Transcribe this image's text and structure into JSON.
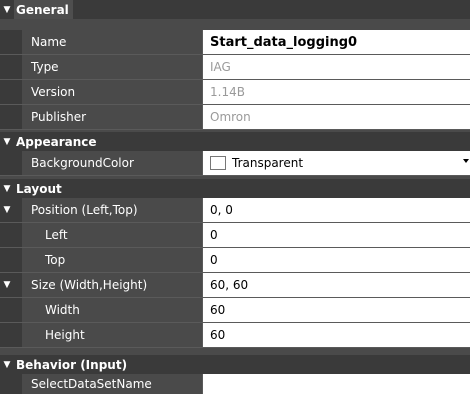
{
  "categories": {
    "general": "General",
    "appearance": "Appearance",
    "layout": "Layout",
    "behavior": "Behavior (Input)"
  },
  "general": {
    "name": {
      "label": "Name",
      "value": "Start_data_logging0"
    },
    "type": {
      "label": "Type",
      "value": "IAG"
    },
    "version": {
      "label": "Version",
      "value": "1.14B"
    },
    "publisher": {
      "label": "Publisher",
      "value": "Omron"
    }
  },
  "appearance": {
    "background_color": {
      "label": "BackgroundColor",
      "value": "Transparent"
    }
  },
  "layout": {
    "position": {
      "label": "Position (Left,Top)",
      "value": "0, 0"
    },
    "left": {
      "label": "Left",
      "value": "0"
    },
    "top": {
      "label": "Top",
      "value": "0"
    },
    "size": {
      "label": "Size (Width,Height)",
      "value": "60, 60"
    },
    "width": {
      "label": "Width",
      "value": "60"
    },
    "height": {
      "label": "Height",
      "value": "60"
    }
  },
  "behavior": {
    "select_dataset": {
      "label": "SelectDataSetName",
      "value": ""
    }
  },
  "glyphs": {
    "expanded": "▼"
  }
}
